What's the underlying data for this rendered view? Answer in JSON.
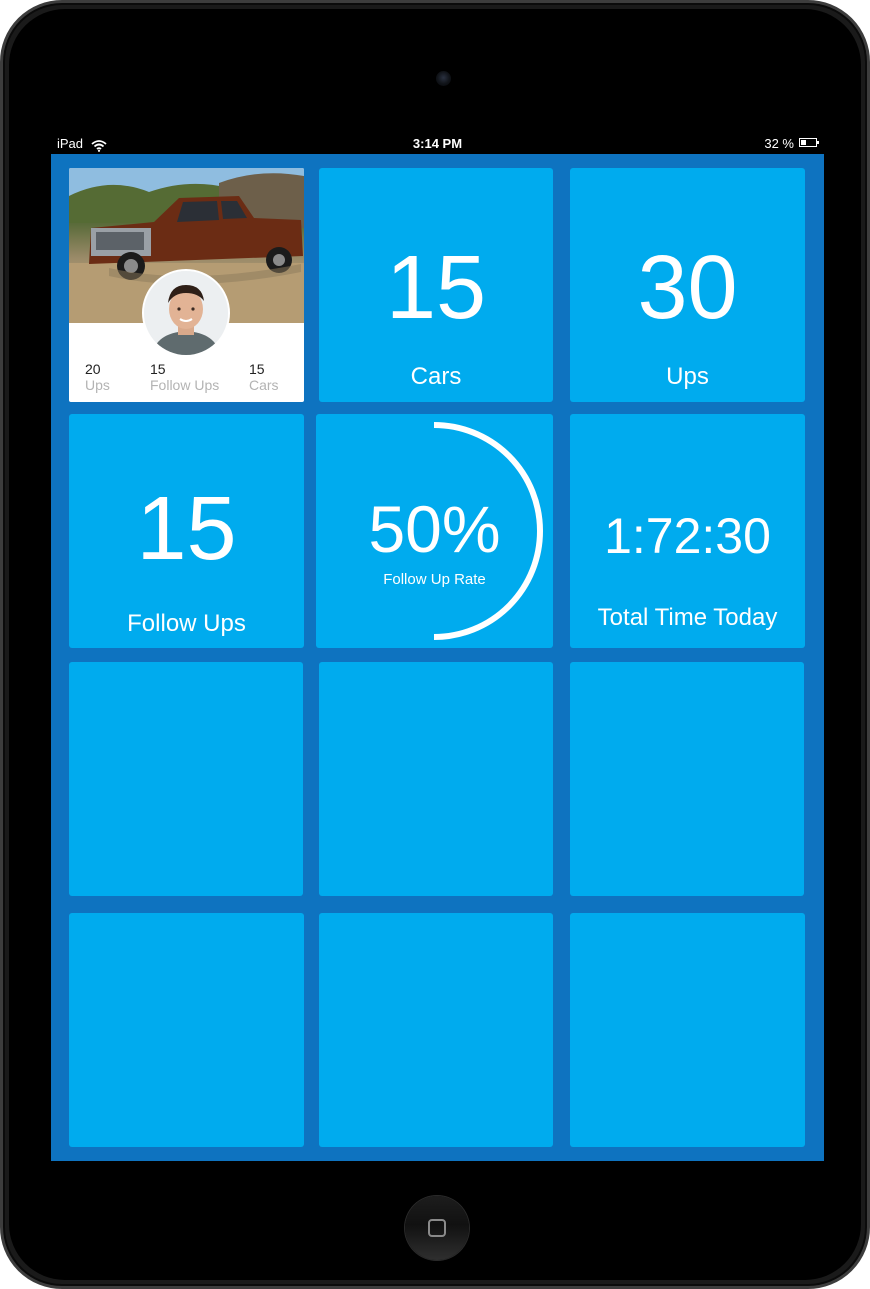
{
  "status_bar": {
    "carrier": "iPad",
    "time": "3:14 PM",
    "battery_percent": "32 %"
  },
  "profile_card": {
    "stats": [
      {
        "value": "20",
        "label": "Ups"
      },
      {
        "value": "15",
        "label": "Follow Ups"
      },
      {
        "value": "15",
        "label": "Cars"
      }
    ]
  },
  "tiles": {
    "cars": {
      "value": "15",
      "label": "Cars"
    },
    "ups": {
      "value": "30",
      "label": "Ups"
    },
    "follow_ups": {
      "value": "15",
      "label": "Follow Ups"
    },
    "follow_up_rate": {
      "value": "50%",
      "label": "Follow Up Rate",
      "fraction": 0.5
    },
    "total_time": {
      "value": "1:72:30",
      "label": "Total Time Today"
    }
  },
  "colors": {
    "background": "#0e73c0",
    "tile": "#00abee",
    "text": "#ffffff"
  }
}
